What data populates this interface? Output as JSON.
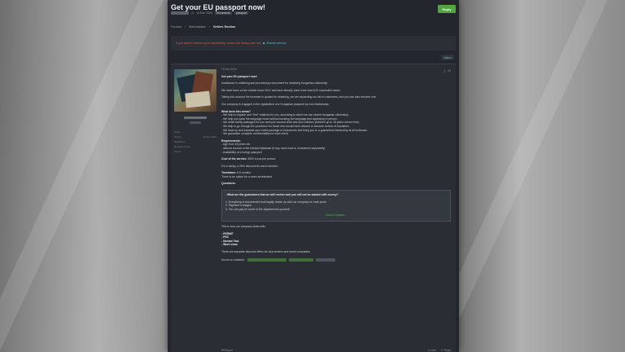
{
  "thread": {
    "title": "Get your EU passport now!",
    "date": "13 Dec 2024",
    "tags": [
      "documents",
      "passport"
    ],
    "reply_label": "Reply"
  },
  "breadcrumbs": [
    "Forums",
    "Marketplace",
    "Sellers Section"
  ],
  "notice": {
    "warning": "If you want to service your frustratedly, scores are always use one",
    "link_label": "Escrow service"
  },
  "subscribe_label": "Watch",
  "post": {
    "date": "13 Dec 2024",
    "user_stats": [
      {
        "label": "Posts",
        "value": ""
      },
      {
        "label": "Joined",
        "value": "11 Dec 2024"
      },
      {
        "label": "Reactions",
        "value": ""
      },
      {
        "label": "Reaction score",
        "value": ""
      },
      {
        "label": "Points",
        "value": ""
      }
    ],
    "heading": "Get your EU passport now!",
    "paragraphs": [
      "Assistance in obtaining and processing a document for obtaining Hungarian citizenship.",
      "We have been on the market since 2012 and have already done more than 610 successful cases.",
      "Taking into account the increase in quotas for obtaining, we are expanding our list of customers, and you can also become one.",
      "Our company is engaged in the registration of a Hungarian passport by root relationship."
    ],
    "what_heading": "What does this mean?",
    "what_items": [
      "- We help to register and \"find\" relatives for you, according to which we can obtain Hungarian citizenship.",
      "- We help you pass the language exam without knowing the language and appearing in person.",
      "- We make family packages for you and your second child and your children (children up to 18 years old are free)",
      "- We help to go through the procedure for those who would have refused or become victims of fraudsters.",
      "- We draw up and translate your entire package of documents and bring you to a guaranteed citizenship at all instances.",
      "- We guarantee complete confidentiality for each client."
    ],
    "req_heading": "Requirements:",
    "req_items": [
      "- Age from 18 years old",
      "- without records in the Interpol database (if any, each case is considered separately)",
      "- Availability of a foreign passport"
    ],
    "cost_label": "Cost of the service:",
    "cost_value": "3500 euros per person",
    "family_note": "For a family, a 25% discount for each member.",
    "timeframe_label": "Timeframe:",
    "timeframe_value": "6-9 months",
    "timeframe_note": "There is an option for a more accelerated",
    "questions_heading": "Questions:",
    "question": "- What are the guarantees that we will receive and you will not be wasted with money?",
    "answers": [
      "1. Everything is documented and legally drawn up with our company on each point",
      "2. Payment in stages",
      "3. You can pay for some of the departments yourself."
    ],
    "expand_label": "Click to expand...",
    "deals_intro": "This is how our company deals with:",
    "deals": [
      "- PERMIT",
      "- PRC",
      "- Nomad Visa",
      "- Work visas"
    ],
    "discount_note": "There are separate discount offers for visa centers and travel companies.",
    "contacts_label": "Knock on contacts:",
    "report_label": "Report",
    "like_label": "Like",
    "reply_label": "Reply"
  }
}
